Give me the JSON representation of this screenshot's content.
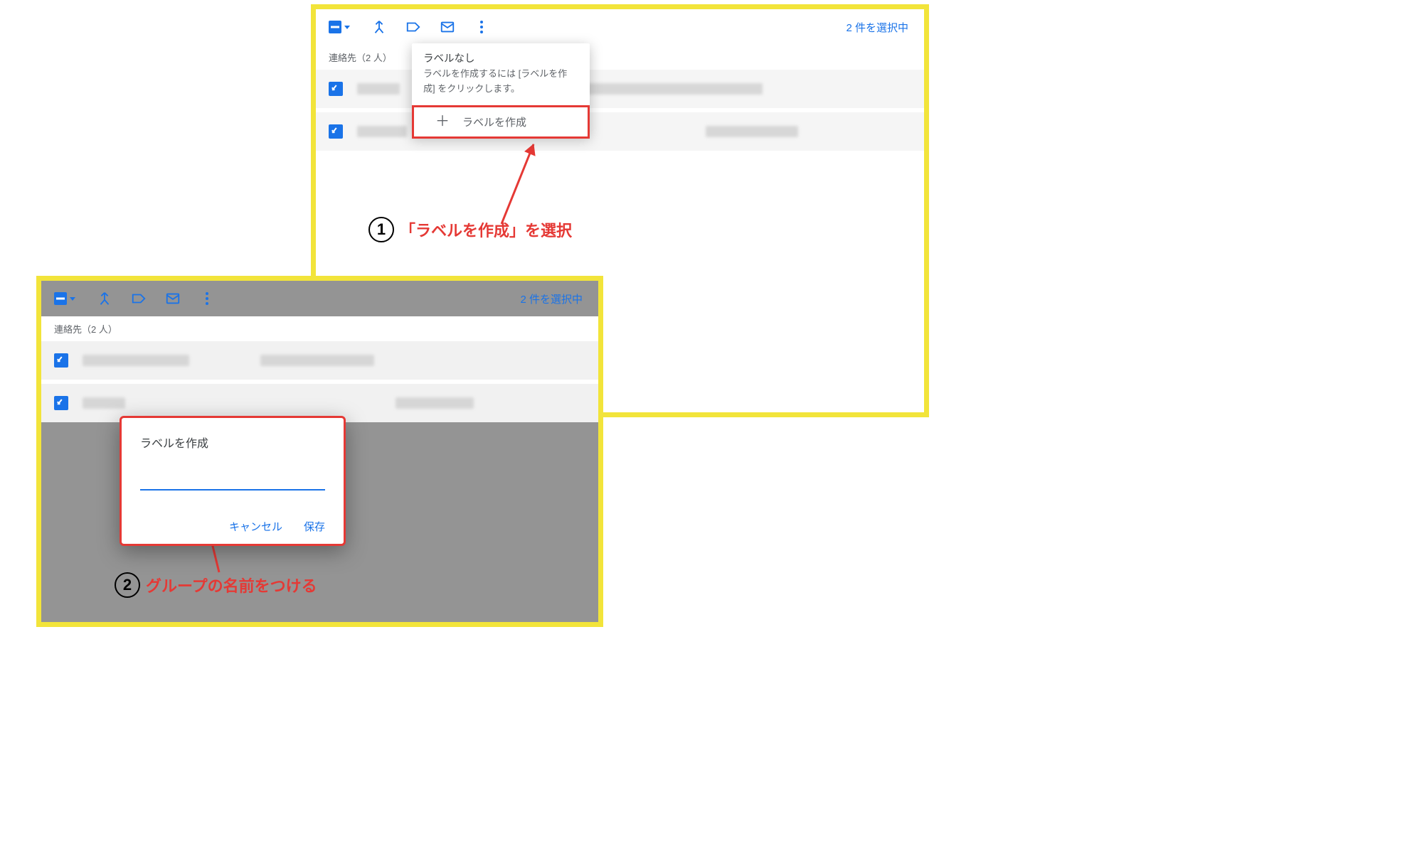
{
  "panelA": {
    "selection_count_text": "2 件を選択中",
    "list_header": "連絡先（2 人）",
    "popup": {
      "title": "ラベルなし",
      "subtitle": "ラベルを作成するには [ラベルを作成] をクリックします。",
      "create_label": "ラベルを作成"
    }
  },
  "panelB": {
    "selection_count_text": "2 件を選択中",
    "list_header": "連絡先（2 人）",
    "dialog": {
      "title": "ラベルを作成",
      "input_value": "",
      "cancel": "キャンセル",
      "save": "保存"
    }
  },
  "annotations": {
    "step1_number": "1",
    "step1_text": "「ラベルを作成」を選択",
    "step2_number": "2",
    "step2_text": "グループの名前をつける"
  }
}
